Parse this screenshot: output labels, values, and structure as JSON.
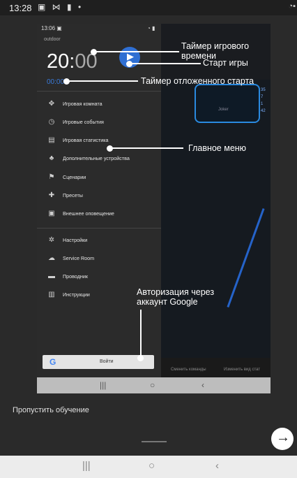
{
  "outer_status": {
    "time": "13:28",
    "icons": "▣ ⋈ ▮ •",
    "right_icons": "◔▪"
  },
  "inner": {
    "status_time": "13:06 ▣",
    "status_icons": "◔ ▮",
    "account": "outdoor",
    "timer_main": "20:",
    "timer_dim": "00",
    "delayed_timer": "00:00",
    "menu": [
      {
        "icon": "joystick-icon",
        "glyph": "✥",
        "label": "Игровая комната"
      },
      {
        "icon": "clock-icon",
        "glyph": "◷",
        "label": "Игровые события"
      },
      {
        "icon": "chart-icon",
        "glyph": "▤",
        "label": "Игровая статистика"
      },
      {
        "icon": "devices-icon",
        "glyph": "♣",
        "label": "Дополнительные устройства"
      },
      {
        "icon": "flag-icon",
        "glyph": "⚑",
        "label": "Сценарии"
      },
      {
        "icon": "puzzle-icon",
        "glyph": "✚",
        "label": "Пресеты"
      },
      {
        "icon": "notification-icon",
        "glyph": "▣",
        "label": "Внешнее оповещение"
      }
    ],
    "menu2": [
      {
        "icon": "gear-icon",
        "glyph": "✲",
        "label": "Настройки"
      },
      {
        "icon": "cloud-icon",
        "glyph": "☁",
        "label": "Service Room"
      },
      {
        "icon": "folder-icon",
        "glyph": "▬",
        "label": "Проводник"
      },
      {
        "icon": "book-icon",
        "glyph": "▥",
        "label": "Инструкции"
      }
    ],
    "google_g": "G",
    "google_label": "Войти",
    "card_label": "Joker",
    "side_numbers": [
      "35",
      "7",
      "1",
      "42"
    ],
    "bottom_actions": [
      "Сменить команды",
      "Изменить вид стат"
    ],
    "nav": {
      "recents": "|||",
      "home": "○",
      "back": "‹"
    }
  },
  "annotations": {
    "game_timer": "Таймер игрового\nвремени",
    "start_game": "Старт игры",
    "delayed_start": "Таймер отложенного старта",
    "main_menu": "Главное меню",
    "google_auth": "Авторизация через\nаккаунт Google"
  },
  "skip_label": "Пропустить обучение",
  "next_glyph": "→",
  "outer_nav": {
    "recents": "|||",
    "home": "○",
    "back": "‹"
  },
  "colors": {
    "accent": "#2f6fd3",
    "background": "#2a2a2a"
  }
}
